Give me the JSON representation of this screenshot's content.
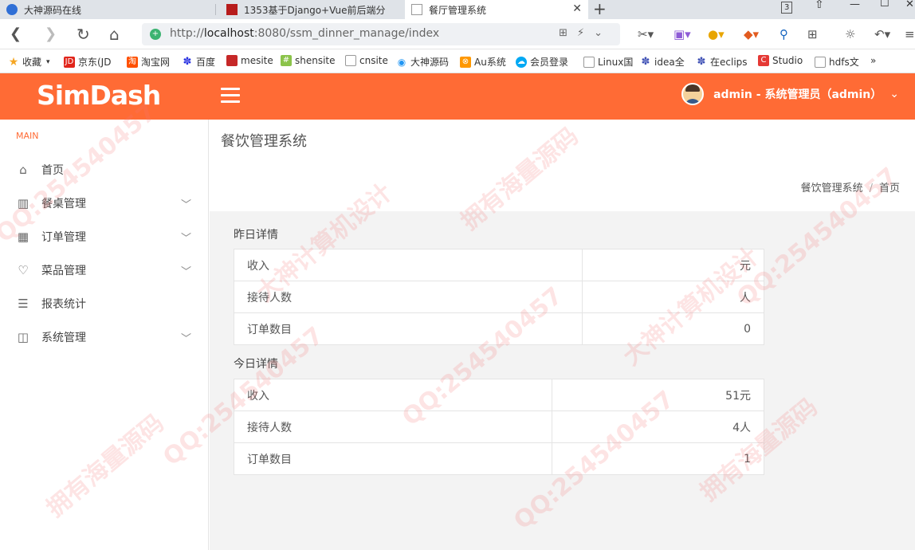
{
  "browser": {
    "tabs": [
      {
        "title": "大神源码在线"
      },
      {
        "title": "1353基于Django+Vue前后端分"
      },
      {
        "title": "餐厅管理系统"
      }
    ],
    "tab_count_badge": "3",
    "url_prefix": "http://",
    "url_host": "localhost",
    "url_rest": ":8080/ssm_dinner_manage/index",
    "bookmarks": [
      {
        "label": "收藏",
        "color": "#f5a623"
      },
      {
        "label": "京东(JD",
        "color": "#e1251b"
      },
      {
        "label": "淘宝网",
        "color": "#ff5000"
      },
      {
        "label": "百度",
        "color": "#2932e1"
      },
      {
        "label": "mesite",
        "color": "#c62828"
      },
      {
        "label": "shensite",
        "color": "#8bc34a"
      },
      {
        "label": "cnsite",
        "color": "#9e9e9e"
      },
      {
        "label": "大神源码",
        "color": "#2196f3"
      },
      {
        "label": "Au系统",
        "color": "#ff9800"
      },
      {
        "label": "会员登录",
        "color": "#03a9f4"
      },
      {
        "label": "Linux国",
        "color": "#9e9e9e"
      },
      {
        "label": "idea全",
        "color": "#3f51b5"
      },
      {
        "label": "在eclips",
        "color": "#3f51b5"
      },
      {
        "label": "Studio",
        "color": "#e53935"
      },
      {
        "label": "hdfs文",
        "color": "#9e9e9e"
      }
    ],
    "bookmarks_more": "»"
  },
  "header": {
    "logo": "SimDash",
    "user_label": "admin - 系统管理员（admin）",
    "accent": "#ff6b35"
  },
  "sidebar": {
    "section": "MAIN",
    "items": [
      {
        "label": "首页",
        "icon": "home-icon",
        "expandable": false
      },
      {
        "label": "餐桌管理",
        "icon": "table-icon",
        "expandable": true
      },
      {
        "label": "订单管理",
        "icon": "grid-icon",
        "expandable": true
      },
      {
        "label": "菜品管理",
        "icon": "heart-icon",
        "expandable": true
      },
      {
        "label": "报表统计",
        "icon": "list-icon",
        "expandable": false
      },
      {
        "label": "系统管理",
        "icon": "layout-icon",
        "expandable": true
      }
    ]
  },
  "main": {
    "title": "餐饮管理系统",
    "breadcrumb": [
      "餐饮管理系统",
      "首页"
    ],
    "yesterday": {
      "label": "昨日详情",
      "rows": [
        {
          "name": "收入",
          "value": "元"
        },
        {
          "name": "接待人数",
          "value": "人"
        },
        {
          "name": "订单数目",
          "value": "0"
        }
      ]
    },
    "today": {
      "label": "今日详情",
      "rows": [
        {
          "name": "收入",
          "value": "51元"
        },
        {
          "name": "接待人数",
          "value": "4人"
        },
        {
          "name": "订单数目",
          "value": "1"
        }
      ]
    }
  },
  "watermarks": [
    "QQ:254540457",
    "大神计算机设计",
    "拥有海量源码"
  ]
}
